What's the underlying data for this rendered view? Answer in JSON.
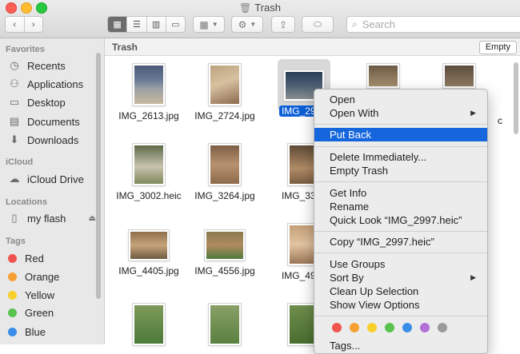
{
  "window": {
    "title": "Trash"
  },
  "toolbar": {
    "search_placeholder": "Search"
  },
  "sidebar": {
    "favorites_head": "Favorites",
    "favorites": [
      {
        "label": "Recents",
        "icon": "clock-icon"
      },
      {
        "label": "Applications",
        "icon": "applications-icon"
      },
      {
        "label": "Desktop",
        "icon": "desktop-icon"
      },
      {
        "label": "Documents",
        "icon": "document-icon"
      },
      {
        "label": "Downloads",
        "icon": "download-icon"
      }
    ],
    "icloud_head": "iCloud",
    "icloud": [
      {
        "label": "iCloud Drive",
        "icon": "cloud-icon"
      }
    ],
    "locations_head": "Locations",
    "locations": [
      {
        "label": "my flash",
        "icon": "drive-icon"
      }
    ],
    "tags_head": "Tags",
    "tags": [
      {
        "label": "Red",
        "color": "#f0544f"
      },
      {
        "label": "Orange",
        "color": "#f5a033"
      },
      {
        "label": "Yellow",
        "color": "#f7d02c"
      },
      {
        "label": "Green",
        "color": "#5ac24d"
      },
      {
        "label": "Blue",
        "color": "#3a8ee8"
      }
    ]
  },
  "pathbar": {
    "name": "Trash",
    "empty_label": "Empty"
  },
  "files": [
    "IMG_2613.jpg",
    "IMG_2724.jpg",
    "IMG_2997.heic",
    "IMG_3002.heic",
    "IMG_3264.jpg",
    "IMG_4405.jpg",
    "IMG_4556.jpg"
  ],
  "selected_file_label": "IMG_2997",
  "partial_labels": {
    "r2": "IMG_3320",
    "r3": "IMG_4905",
    "c5": "c"
  },
  "menu": {
    "open": "Open",
    "open_with": "Open With",
    "put_back": "Put Back",
    "delete_immediately": "Delete Immediately...",
    "empty_trash": "Empty Trash",
    "get_info": "Get Info",
    "rename": "Rename",
    "quick_look": "Quick Look “IMG_2997.heic”",
    "copy": "Copy “IMG_2997.heic”",
    "use_groups": "Use Groups",
    "sort_by": "Sort By",
    "clean_up": "Clean Up Selection",
    "show_view_options": "Show View Options",
    "tags_partial": "Tags...",
    "tag_colors": [
      "#f0544f",
      "#f5a033",
      "#f7d02c",
      "#5ac24d",
      "#3a8ee8",
      "#b46fd8",
      "#9a9a9a"
    ]
  }
}
